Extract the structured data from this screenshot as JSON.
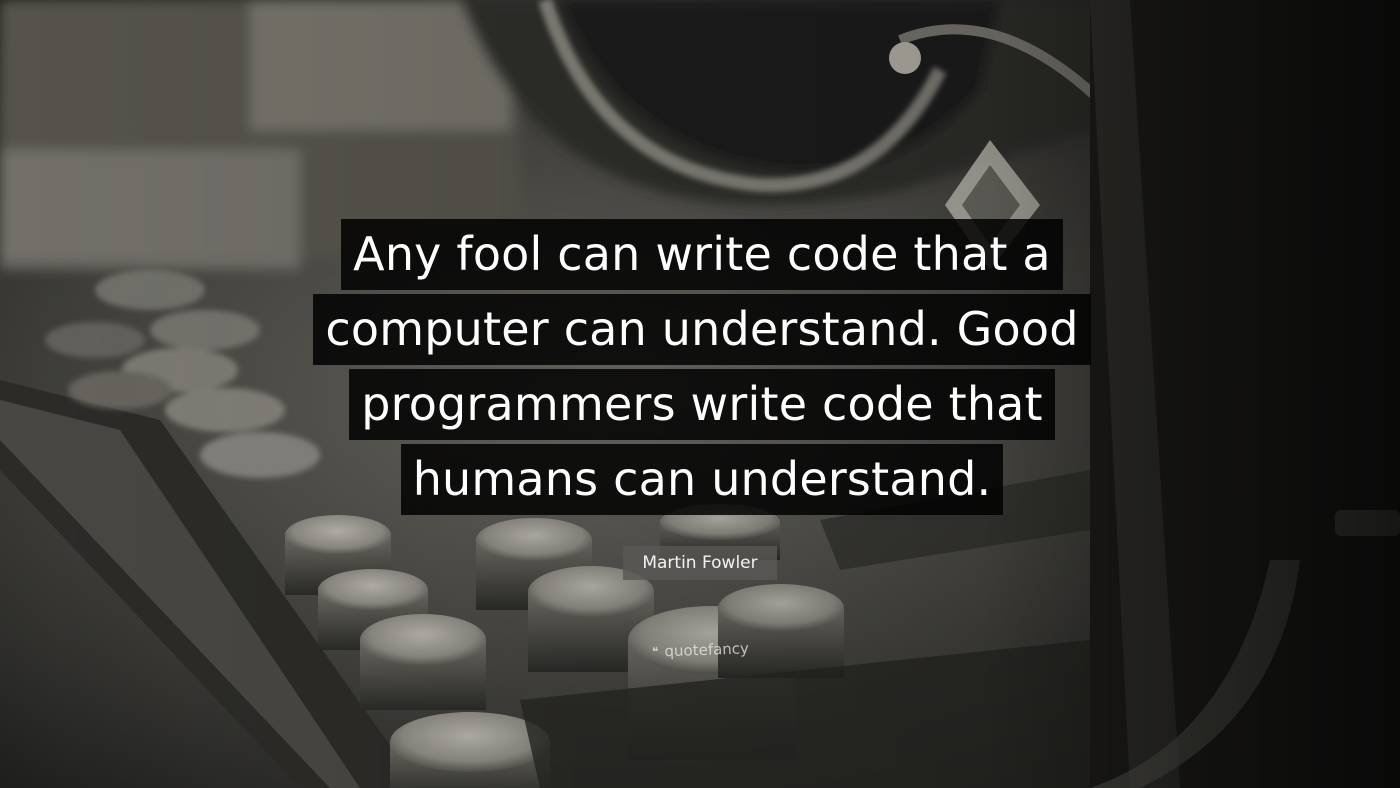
{
  "quote": {
    "lines": [
      "Any fool can write code that a",
      "computer can understand. Good",
      "programmers write code that",
      "humans can understand."
    ],
    "author": "Martin Fowler"
  },
  "watermark": {
    "icon": "quote-mark-icon",
    "glyph": "❝",
    "text": "quotefancy"
  },
  "colors": {
    "quote_text": "#ffffff",
    "quote_band": "#000000",
    "author_badge": "#5a5854"
  }
}
